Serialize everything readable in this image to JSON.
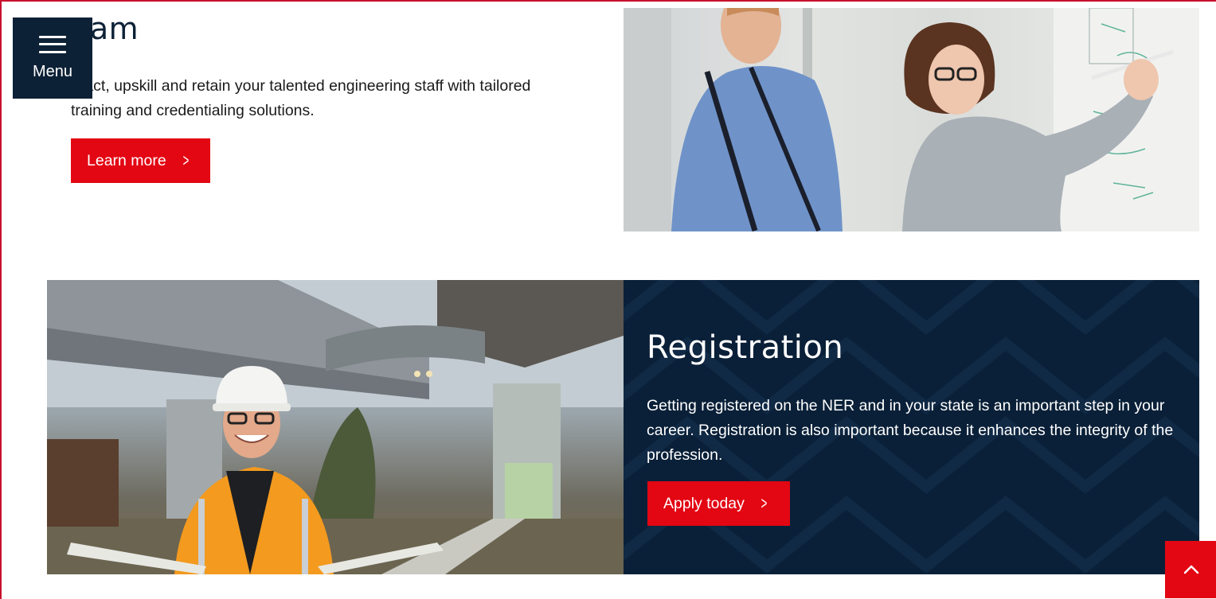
{
  "menu": {
    "label": "Menu",
    "icon": "hamburger-icon"
  },
  "team_section": {
    "heading": "eam",
    "description": "ttract, upskill and retain your talented engineering staff with tailored training and credentialing solutions.",
    "button_label": "Learn more",
    "button_icon": "chevron-right-icon"
  },
  "registration": {
    "title": "Registration",
    "description": "Getting registered on the NER and in your state is an important step in your career. Registration is also important because it enhances the integrity of the profession.",
    "button_label": "Apply today",
    "button_icon": "chevron-right-icon"
  },
  "back_to_top": {
    "icon": "chevron-up-icon"
  },
  "colors": {
    "brand_red": "#e30613",
    "navy": "#0a2038",
    "text_dark": "#1a1a1a"
  }
}
